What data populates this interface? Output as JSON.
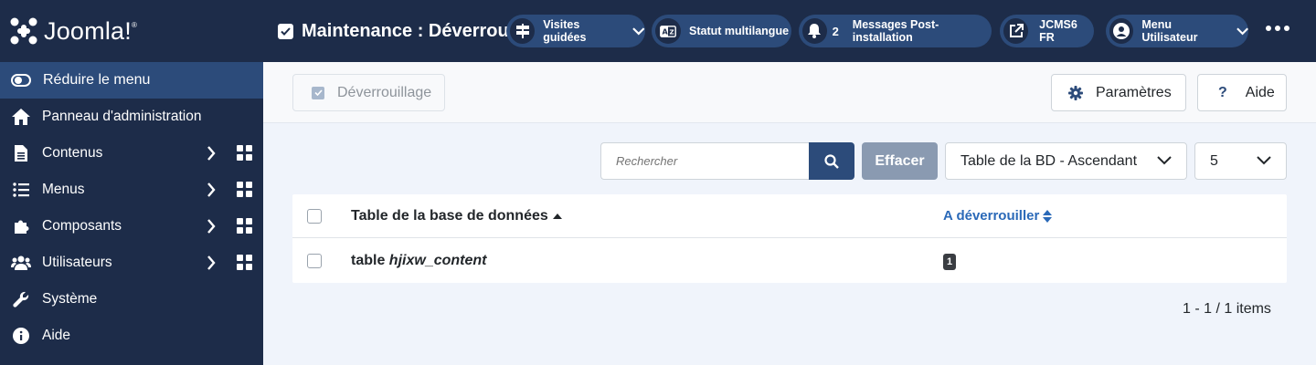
{
  "brand": {
    "name": "Joomla!",
    "trademark": "®"
  },
  "sidebar": {
    "toggle_label": "Réduire le menu",
    "items": [
      {
        "label": "Panneau d'administration",
        "icon": "home-icon",
        "has_children": false
      },
      {
        "label": "Contenus",
        "icon": "file-icon",
        "has_children": true
      },
      {
        "label": "Menus",
        "icon": "list-icon",
        "has_children": true
      },
      {
        "label": "Composants",
        "icon": "puzzle-icon",
        "has_children": true
      },
      {
        "label": "Utilisateurs",
        "icon": "users-icon",
        "has_children": true
      },
      {
        "label": "Système",
        "icon": "wrench-icon",
        "has_children": false
      },
      {
        "label": "Aide",
        "icon": "info-icon",
        "has_children": false
      }
    ]
  },
  "header": {
    "title": "Maintenance : Déverrouillage",
    "pills": {
      "tours": "Visites guidées",
      "multilang": "Statut multilangue",
      "messages_count": "2",
      "messages": "Messages Post-installation",
      "site": "JCMS6 FR",
      "user": "Menu Utilisateur"
    }
  },
  "toolbar": {
    "unlock_label": "Déverrouillage",
    "options_label": "Paramètres",
    "help_label": "Aide"
  },
  "filters": {
    "search_placeholder": "Rechercher",
    "clear_label": "Effacer",
    "ordering_value": "Table de la BD - Ascendant",
    "limit_value": "5"
  },
  "table": {
    "headers": {
      "table_name": "Table de la base de données",
      "to_unlock": "A déverrouiller"
    },
    "rows": [
      {
        "prefix": "table",
        "name": "hjixw_content",
        "count": "1"
      }
    ]
  },
  "pagination": {
    "info": "1 - 1 / 1 items"
  },
  "colors": {
    "sidebar_bg": "#1d2c49",
    "accent": "#2c4b7a",
    "link": "#2a69b8",
    "clear_btn": "#8a9ab1"
  }
}
